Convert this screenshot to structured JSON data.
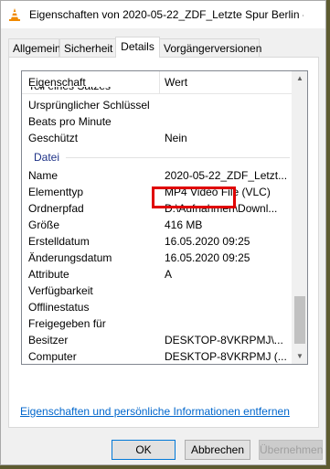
{
  "window": {
    "title": "Eigenschaften von 2020-05-22_ZDF_Letzte Spur Berlin -...",
    "app_icon": "vlc-cone-icon"
  },
  "tabs": [
    {
      "label": "Allgemein",
      "active": false
    },
    {
      "label": "Sicherheit",
      "active": false
    },
    {
      "label": "Details",
      "active": true
    },
    {
      "label": "Vorgängerversionen",
      "active": false
    }
  ],
  "list": {
    "header": {
      "property": "Eigenschaft",
      "value": "Wert"
    },
    "rows_before_group": [
      {
        "key": "Teil eines Satzes",
        "value": ""
      },
      {
        "key": "Ursprünglicher Schlüssel",
        "value": ""
      },
      {
        "key": "Beats pro Minute",
        "value": ""
      },
      {
        "key": "Geschützt",
        "value": "Nein"
      }
    ],
    "group_label": "Datei",
    "rows_after_group": [
      {
        "key": "Name",
        "value": "2020-05-22_ZDF_Letzt..."
      },
      {
        "key": "Elementtyp",
        "value": "MP4 Video File (VLC)"
      },
      {
        "key": "Ordnerpfad",
        "value": "D:\\Aufnahmen\\Downl..."
      },
      {
        "key": "Größe",
        "value": "416 MB"
      },
      {
        "key": "Erstelldatum",
        "value": "16.05.2020 09:25"
      },
      {
        "key": "Änderungsdatum",
        "value": "16.05.2020 09:25"
      },
      {
        "key": "Attribute",
        "value": "A"
      },
      {
        "key": "Verfügbarkeit",
        "value": ""
      },
      {
        "key": "Offlinestatus",
        "value": ""
      },
      {
        "key": "Freigegeben für",
        "value": ""
      },
      {
        "key": "Besitzer",
        "value": "DESKTOP-8VKRPMJ\\..."
      },
      {
        "key": "Computer",
        "value": "DESKTOP-8VKRPMJ (..."
      }
    ]
  },
  "link": "Eigenschaften und persönliche Informationen entfernen",
  "buttons": {
    "ok": "OK",
    "cancel": "Abbrechen",
    "apply": "Übernehmen"
  },
  "colors": {
    "highlight": "#e00000",
    "link": "#0066cc",
    "group_label": "#1e3287"
  }
}
